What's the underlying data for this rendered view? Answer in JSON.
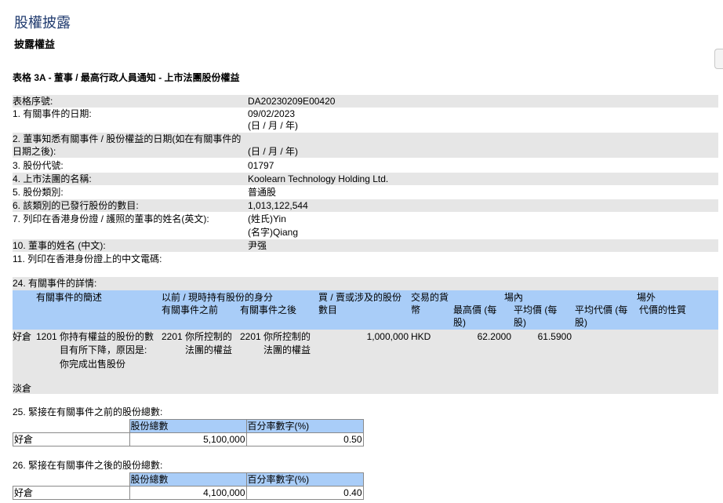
{
  "page": {
    "title": "股權披露",
    "subtitle": "披露權益",
    "form_title": "表格 3A - 董事 / 最高行政人員通知 - 上市法團股份權益"
  },
  "fields": {
    "serial_label": "表格序號:",
    "serial_value": "DA20230209E00420",
    "event_date_label": "1. 有關事件的日期:",
    "event_date_value": "09/02/2023",
    "event_date_fmt": "(日 / 月 / 年)",
    "aware_date_label_1": "2. 董事知悉有關事件 / 股份權益的日期(如在有關事件的",
    "aware_date_label_2": "日期之後):",
    "aware_date_fmt": "(日 / 月 / 年)",
    "stock_code_label": "3. 股份代號:",
    "stock_code_value": "01797",
    "corp_name_label": "4. 上市法團的名稱:",
    "corp_name_value": "Koolearn Technology Holding Ltd.",
    "share_class_label": "5. 股份類別:",
    "share_class_value": "普通股",
    "issued_label": "6. 該類別的已發行股份的數目:",
    "issued_value": "1,013,122,544",
    "eng_name_label": "7. 列印在香港身份證 / 護照的董事的姓名(英文):",
    "surname_value": "(姓氏)Yin",
    "given_name_value": "(名字)Qiang",
    "chi_name_label": "10. 董事的姓名 (中文):",
    "chi_name_value": "尹强",
    "telecode_label": "11. 列印在香港身份證上的中文電碼:"
  },
  "events": {
    "section_label": "24. 有關事件的詳情:",
    "headers": {
      "desc": "有關事件的簡述",
      "capacity": "以前 / 現時持有股份的身分",
      "before": "有關事件之前",
      "after": "有關事件之後",
      "shares_1": "買 / 賣或涉及的股份",
      "shares_2": "數目",
      "currency_1": "交易的貨",
      "currency_2": "幣",
      "onex": "場內",
      "high_1": "最高價 (每",
      "high_2": "股)",
      "avg_1": "平均價 (每",
      "avg_2": "股)",
      "offex_avg_1": "平均代價 (每",
      "offex_avg_2": "股)",
      "offex": "場外",
      "nature": "代價的性質"
    },
    "long_row": {
      "position": "好倉",
      "code": "1201",
      "desc_1": "你持有權益的股份的數",
      "desc_2": "目有所下降，原因是:",
      "desc_3": "你完成出售股份",
      "before_code": "2201",
      "before_1": "你所控制的",
      "before_2": "法團的權益",
      "after_code": "2201",
      "after_1": "你所控制的",
      "after_2": "法團的權益",
      "shares": "1,000,000",
      "currency": "HKD",
      "high": "62.2000",
      "avg": "61.5900"
    },
    "short_row": {
      "position": "淡倉"
    }
  },
  "before_total": {
    "label": "25. 緊接在有關事件之前的股份總數:",
    "col_shares": "股份總數",
    "col_pct": "百分率數字(%)",
    "position": "好倉",
    "shares": "5,100,000",
    "pct": "0.50"
  },
  "after_total": {
    "label": "26. 緊接在有關事件之後的股份總數:",
    "col_shares": "股份總數",
    "col_pct": "百分率數字(%)",
    "position": "好倉",
    "shares": "4,100,000",
    "pct": "0.40"
  },
  "colors": {
    "title": "#1f3a6e",
    "header_band": "#a9cdf8",
    "grey_band": "#e6e6e6"
  }
}
